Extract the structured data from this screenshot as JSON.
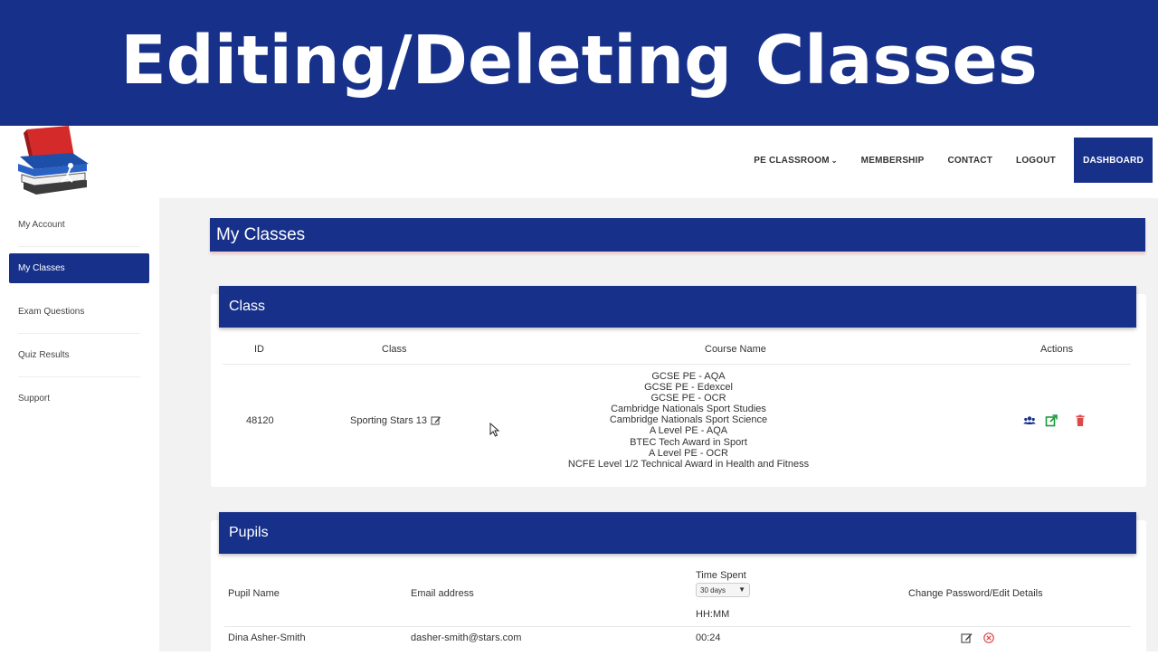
{
  "banner": {
    "title": "Editing/Deleting Classes"
  },
  "nav": {
    "items": [
      {
        "label": "PE CLASSROOM",
        "has_dropdown": true
      },
      {
        "label": "MEMBERSHIP"
      },
      {
        "label": "CONTACT"
      },
      {
        "label": "LOGOUT"
      }
    ],
    "dashboard": "DASHBOARD"
  },
  "sidebar": {
    "items": [
      {
        "label": "My Account"
      },
      {
        "label": "My Classes",
        "active": true
      },
      {
        "label": "Exam Questions"
      },
      {
        "label": "Quiz Results"
      },
      {
        "label": "Support"
      }
    ]
  },
  "page": {
    "title": "My Classes"
  },
  "class_card": {
    "title": "Class",
    "headers": {
      "id": "ID",
      "class": "Class",
      "course": "Course Name",
      "actions": "Actions"
    },
    "row": {
      "id": "48120",
      "class_name": "Sporting Stars 13",
      "courses": [
        "GCSE PE - AQA",
        "GCSE PE - Edexcel",
        "GCSE PE - OCR",
        "Cambridge Nationals Sport Studies",
        "Cambridge Nationals Sport Science",
        "A Level PE - AQA",
        "BTEC Tech Award in Sport",
        "A Level PE - OCR",
        "NCFE Level 1/2 Technical Award in Health and Fitness"
      ]
    }
  },
  "pupils_card": {
    "title": "Pupils",
    "headers": {
      "name": "Pupil Name",
      "email": "Email address",
      "time_spent": "Time Spent",
      "time_unit": "HH:MM",
      "change": "Change Password/Edit Details"
    },
    "period_select": {
      "value": "30 days"
    },
    "rows": [
      {
        "name": "Dina Asher-Smith",
        "email": "dasher-smith@stars.com",
        "time": "00:24"
      }
    ]
  },
  "colors": {
    "primary": "#17318a",
    "edit_green": "#1a9a3a",
    "delete_red": "#e04848",
    "users_blue": "#17318a"
  },
  "icons": {
    "class_edit": "edit-icon",
    "view_pupils": "users-icon",
    "open_class": "external-link-icon",
    "delete_class": "trash-icon",
    "pupil_edit": "edit-icon",
    "pupil_remove": "remove-circle-icon"
  }
}
